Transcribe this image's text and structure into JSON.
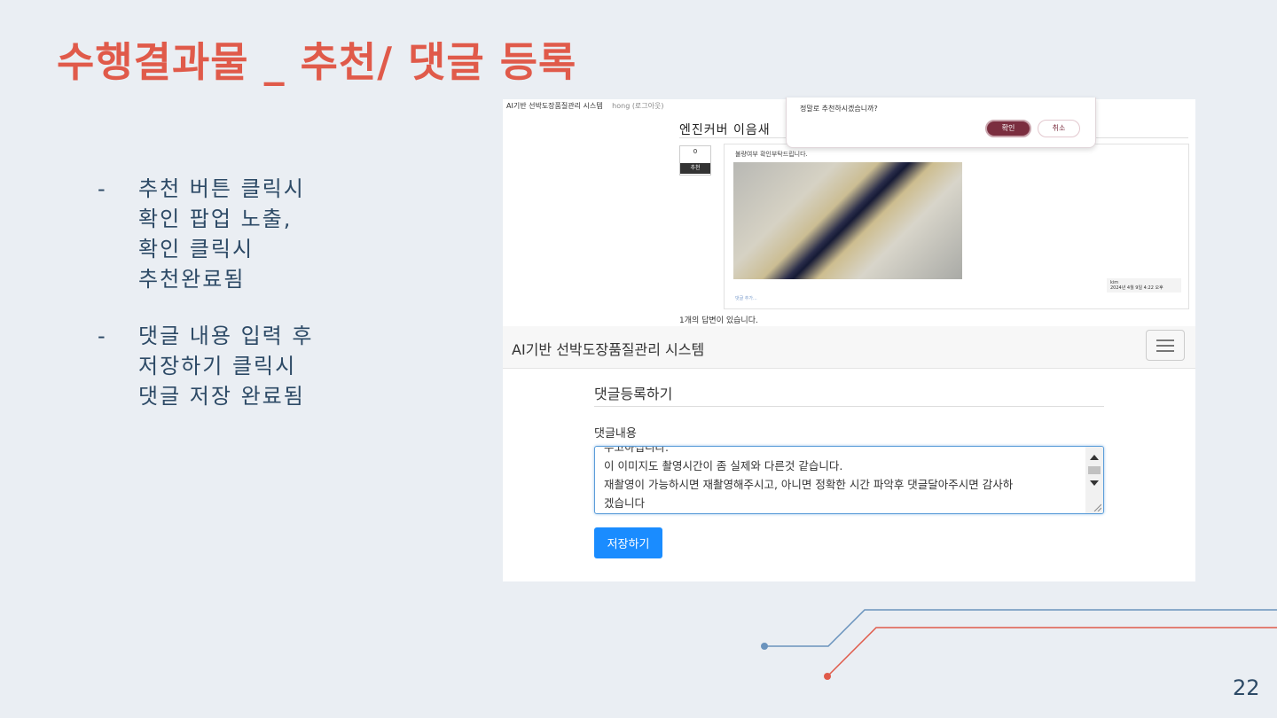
{
  "slide": {
    "title": "수행결과물 _ 추천/ 댓글 등록",
    "page_number": "22",
    "bullets": [
      {
        "dash": "-",
        "text": "추천 버튼 클릭시\n확인 팝업 노출,\n확인 클릭시\n추천완료됨"
      },
      {
        "dash": "-",
        "text": "댓글 내용 입력 후\n저장하기 클릭시\n댓글 저장 완료됨"
      }
    ]
  },
  "screenshot_top": {
    "app_title": "AI기반 선박도장품질관리 시스템",
    "user_link": "hong (로그아웃)",
    "post_title": "엔진커버 이음새",
    "vote_count": "0",
    "vote_button": "추천",
    "post_body": "불량여부 확인부탁드립니다.",
    "author": "kim",
    "date": "2024년 4월 9일 4:22 오후",
    "post_link": "댓글 추가...",
    "answers_count": "1개의 답변이 있습니다.",
    "dialog": {
      "message": "정말로 추천하시겠습니까?",
      "ok": "확인",
      "cancel": "취소"
    }
  },
  "screenshot_bottom": {
    "brand": "AI기반 선박도장품질관리 시스템",
    "form_title": "댓글등록하기",
    "field_label": "댓글내용",
    "textarea_value": "수고하십니다.\n이 이미지도 촬영시간이 좀 실제와 다른것 같습니다.\n재촬영이 가능하시면 재촬영해주시고, 아니면 정확한 시간 파악후 댓글달아주시면 감사하\n겠습니다",
    "save_button": "저장하기"
  },
  "colors": {
    "title": "#e05a4a",
    "bullet_text": "#2d4a66",
    "confirm_button": "#7b2e3f",
    "save_button": "#1a8cff",
    "deco_blue": "#6a93bd",
    "deco_red": "#e05a4a"
  }
}
